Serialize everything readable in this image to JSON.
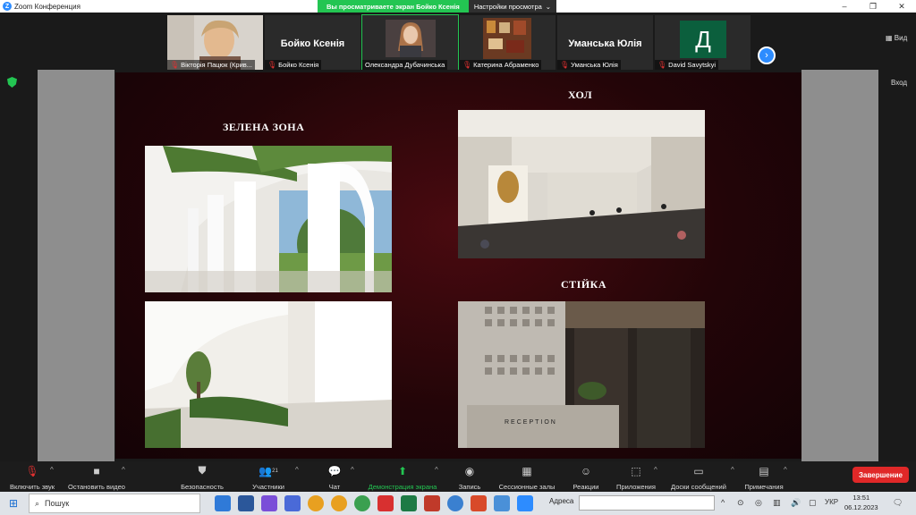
{
  "window": {
    "title": "Zoom Конференция",
    "share_banner": "Вы просматриваете экран Бойко Ксенія",
    "view_options": "Настройки просмотра",
    "view_button": "Вид",
    "enter_button": "Вход"
  },
  "participants": [
    {
      "name": "Вікторія Пацюк (Крив...",
      "muted": true,
      "type": "video"
    },
    {
      "name": "Бойко Ксенія",
      "muted": true,
      "type": "name",
      "big": "Бойко Ксенія"
    },
    {
      "name": "Олександра Дубачинська",
      "muted": false,
      "type": "video",
      "active": true
    },
    {
      "name": "Катерина Абраменко",
      "muted": true,
      "type": "video"
    },
    {
      "name": "Уманська Юлія",
      "muted": true,
      "type": "name",
      "big": "Уманська Юлія"
    },
    {
      "name": "David Savytskyi",
      "muted": true,
      "type": "avatar",
      "initial": "Д"
    }
  ],
  "slide": {
    "green_zone": "ЗЕЛЕНА ЗОНА",
    "hall": "ХОЛ",
    "counter": "СТІЙКА",
    "reception": "RECEPTION"
  },
  "toolbar": {
    "unmute": "Включить звук",
    "stop_video": "Остановить видео",
    "security": "Безопасность",
    "participants": "Участники",
    "participants_count": "21",
    "chat": "Чат",
    "share": "Демонстрация экрана",
    "record": "Запись",
    "breakout": "Сессионные залы",
    "reactions": "Реакции",
    "apps": "Приложения",
    "whiteboards": "Доски сообщений",
    "notes": "Примечания",
    "end": "Завершение"
  },
  "taskbar": {
    "search": "Пошук",
    "address_label": "Адреса",
    "lang": "УКР",
    "time": "13:51",
    "date": "06.12.2023"
  },
  "colors": {
    "zoom_blue": "#2d8cff",
    "share_green": "#23c552",
    "end_red": "#e02828",
    "slide_bg": "#3a070c"
  }
}
